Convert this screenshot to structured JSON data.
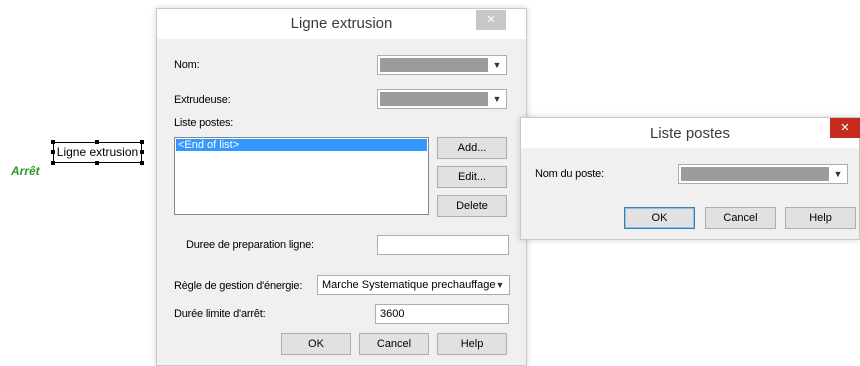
{
  "canvas": {
    "node_label": "Ligne extrusion",
    "node_state": "Arrêt",
    "state_color": "#2e9a2e"
  },
  "dialog_ligne": {
    "title": "Ligne extrusion",
    "close_glyph": "×",
    "nom_label": "Nom:",
    "extrudeuse_label": "Extrudeuse:",
    "liste_postes_label": "Liste postes:",
    "list_items": [
      "<End of list>"
    ],
    "add_label": "Add...",
    "edit_label": "Edit...",
    "delete_label": "Delete",
    "duree_preparation_label": "Duree de preparation ligne:",
    "duree_preparation_value": "",
    "regle_label": "Règle de gestion d'énergie:",
    "regle_value": "Marche Systematique prechauffage",
    "duree_limite_label": "Durée limite d'arrêt:",
    "duree_limite_value": "3600",
    "ok_label": "OK",
    "cancel_label": "Cancel",
    "help_label": "Help",
    "close_color": "#c7c7c7"
  },
  "dialog_liste": {
    "title": "Liste postes",
    "close_glyph": "×",
    "nom_poste_label": "Nom du poste:",
    "ok_label": "OK",
    "cancel_label": "Cancel",
    "help_label": "Help",
    "close_color": "#c42b1c"
  }
}
